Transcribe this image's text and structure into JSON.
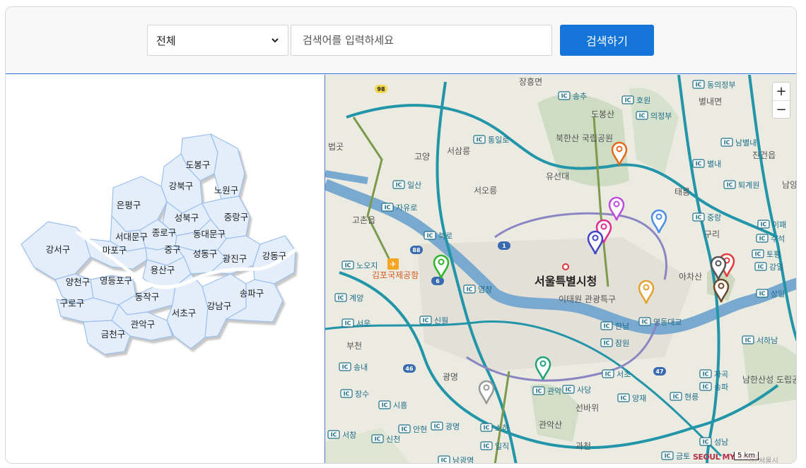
{
  "search": {
    "category_value": "전체",
    "placeholder": "검색어를 입력하세요",
    "button_label": "검색하기"
  },
  "districts": [
    {
      "id": "dobong",
      "name": "도봉구"
    },
    {
      "id": "gangbuk",
      "name": "강북구"
    },
    {
      "id": "nowon",
      "name": "노원구"
    },
    {
      "id": "eunpyeong",
      "name": "은평구"
    },
    {
      "id": "seongbuk",
      "name": "성북구"
    },
    {
      "id": "jungnang",
      "name": "중랑구"
    },
    {
      "id": "seodaemun",
      "name": "서대문구"
    },
    {
      "id": "jongno",
      "name": "종로구"
    },
    {
      "id": "dongdaemun",
      "name": "동대문구"
    },
    {
      "id": "mapo",
      "name": "마포구"
    },
    {
      "id": "jung",
      "name": "중구"
    },
    {
      "id": "seongdong",
      "name": "성동구"
    },
    {
      "id": "gwangjin",
      "name": "광진구"
    },
    {
      "id": "gangdong",
      "name": "강동구"
    },
    {
      "id": "gangseo",
      "name": "강서구"
    },
    {
      "id": "yongsan",
      "name": "용산구"
    },
    {
      "id": "yangcheon",
      "name": "양천구"
    },
    {
      "id": "yeongdeungpo",
      "name": "영등포구"
    },
    {
      "id": "dongjak",
      "name": "동작구"
    },
    {
      "id": "seocho",
      "name": "서초구"
    },
    {
      "id": "gangnam",
      "name": "강남구"
    },
    {
      "id": "songpa",
      "name": "송파구"
    },
    {
      "id": "guro",
      "name": "구로구"
    },
    {
      "id": "gwanak",
      "name": "관악구"
    },
    {
      "id": "geumcheon",
      "name": "금천구"
    }
  ],
  "map": {
    "city_label": "서울특별시청",
    "area_labels": [
      "고양",
      "서삼릉",
      "서오릉",
      "유선대",
      "도봉산",
      "태릉",
      "구리",
      "아차산",
      "이태원 관광특구",
      "광명",
      "부천",
      "선바위",
      "관악산",
      "과천",
      "북한산 국립공원",
      "남양주",
      "진건읍",
      "고촌읍",
      "김포국제공항",
      "남한산성 도립공원",
      "법곳",
      "별내면",
      "장흥면"
    ],
    "ic_labels": [
      "송추",
      "호원",
      "의정부",
      "동의정부",
      "통일로",
      "일산",
      "자유로",
      "북로",
      "노오지",
      "계양",
      "서운",
      "신월",
      "염창",
      "영동대교",
      "한남",
      "잠원",
      "서초",
      "양재",
      "현릉",
      "자곡",
      "송파",
      "서하남",
      "상일",
      "강일",
      "토평",
      "수석",
      "이패",
      "퇴계원",
      "별내",
      "남별내",
      "중랑",
      "광명",
      "소하",
      "일직",
      "남광명",
      "안현",
      "신천",
      "시흥",
      "장수",
      "송내",
      "서창",
      "관악",
      "사당",
      "성남",
      "금토",
      "88",
      "6",
      "1",
      "46",
      "47",
      "98"
    ],
    "zoom_in": "+",
    "zoom_out": "−",
    "scale_label": "5 km",
    "logo_text": "SEOUL MY SOUL",
    "copyright": "ⓒ 서울시"
  }
}
